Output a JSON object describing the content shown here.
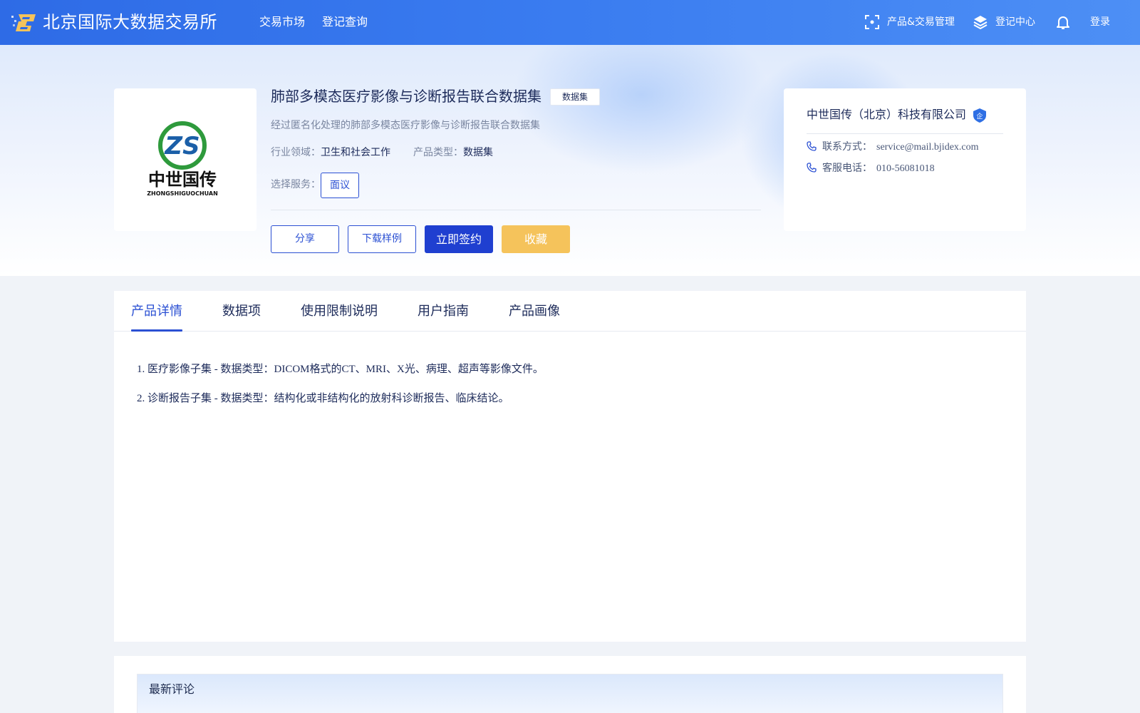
{
  "header": {
    "site_title": "北京国际大数据交易所",
    "nav": [
      "交易市场",
      "登记查询"
    ],
    "product_mgmt": "产品&交易管理",
    "register_center": "登记中心",
    "login": "登录",
    "icons": [
      "scan-icon",
      "layers-icon",
      "bell-icon"
    ]
  },
  "product": {
    "title": "肺部多模态医疗影像与诊断报告联合数据集",
    "tag": "数据集",
    "description": "经过匿名化处理的肺部多模态医疗影像与诊断报告联合数据集",
    "industry_label": "行业领域：",
    "industry_value": "卫生和社会工作",
    "type_label": "产品类型：",
    "type_value": "数据集",
    "service_label": "选择服务：",
    "service_option": "面议",
    "logo_text": "中世国传",
    "logo_subtext": "ZHONGSHIGUOCHUAN",
    "logo_monogram": "ZS"
  },
  "actions": {
    "share": "分享",
    "download_sample": "下载样例",
    "sign_now": "立即签约",
    "favorite": "收藏"
  },
  "company": {
    "name": "中世国传（北京）科技有限公司",
    "badge": "企",
    "contact_label": "联系方式：",
    "contact_value": "service@mail.bjidex.com",
    "phone_label": "客服电话：",
    "phone_value": "010-56081018"
  },
  "tabs": [
    "产品详情",
    "数据项",
    "使用限制说明",
    "用户指南",
    "产品画像"
  ],
  "active_tab": "产品详情",
  "details": [
    "1. 医疗影像子集 - 数据类型：DICOM格式的CT、MRI、X光、病理、超声等影像文件。",
    "2. 诊断报告子集 - 数据类型：结构化或非结构化的放射科诊断报告、临床结论。"
  ],
  "comments": {
    "title": "最新评论"
  },
  "colors": {
    "nav_bg": "#3a7cf0",
    "primary": "#1f3fd0",
    "accent_outline": "#2b50d3",
    "favorite": "#f5c35b",
    "logo_green": "#2e9a3c",
    "logo_blue": "#1b5fa8"
  }
}
